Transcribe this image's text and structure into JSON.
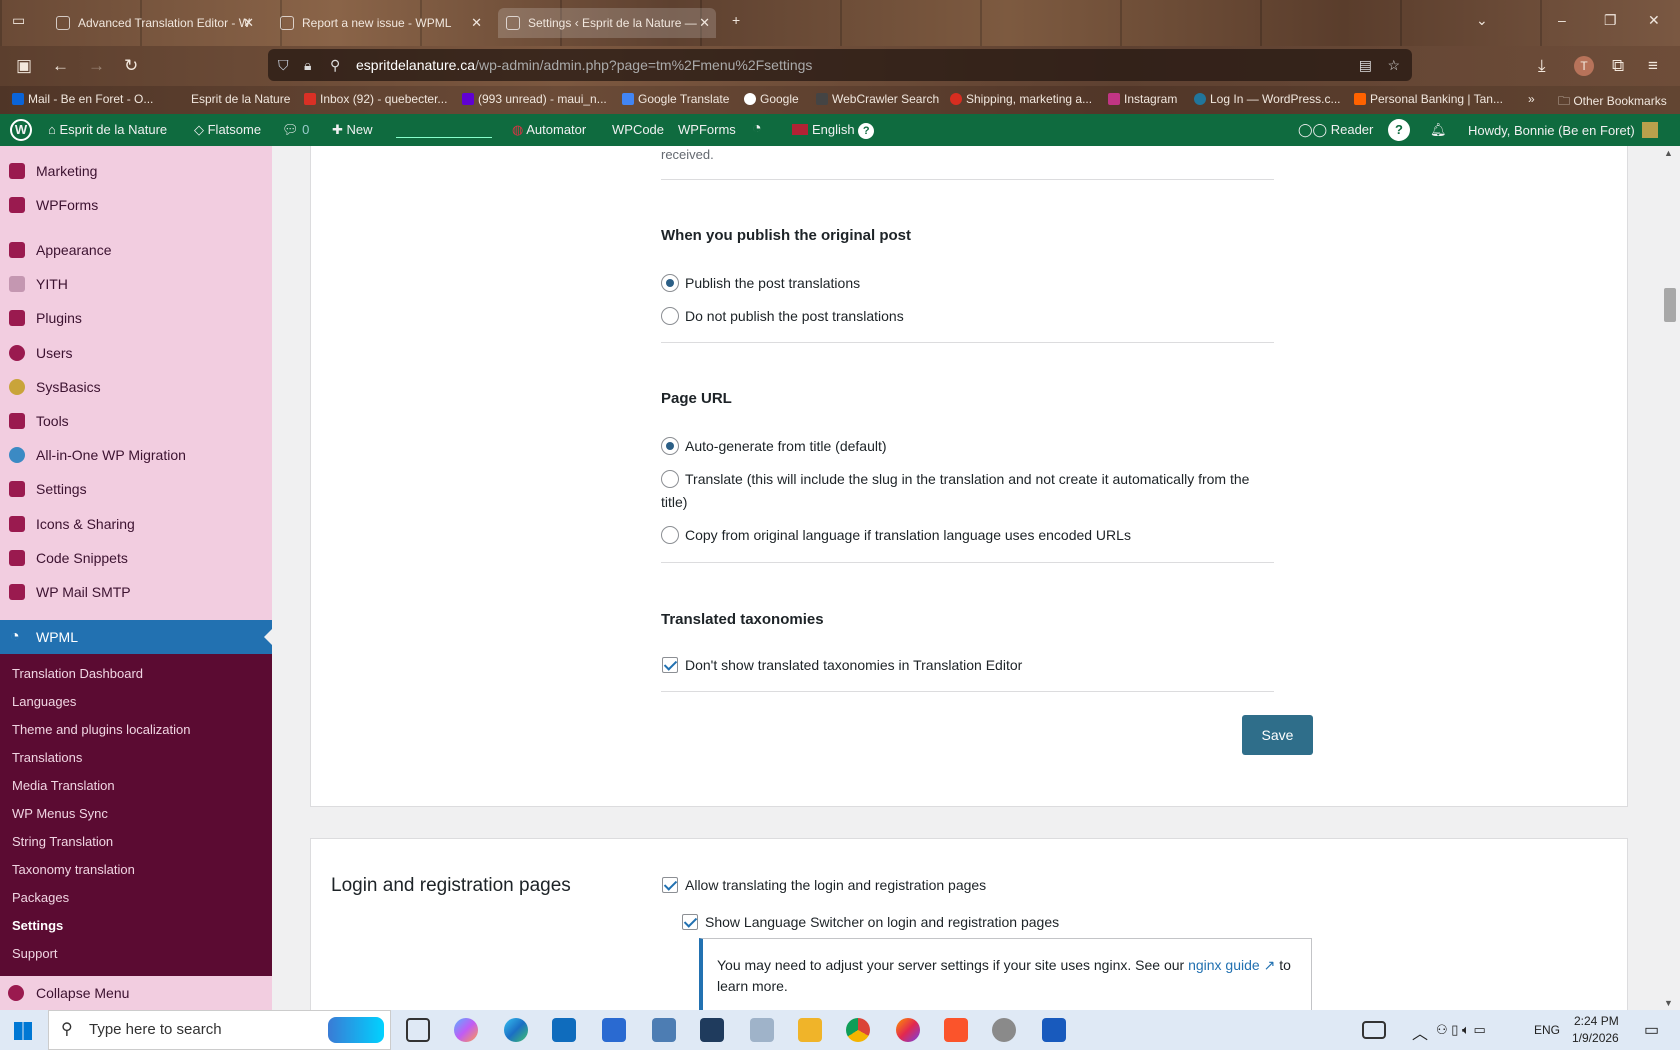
{
  "browser": {
    "tabs": [
      {
        "label": "Advanced Translation Editor - W"
      },
      {
        "label": "Report a new issue - WPML"
      },
      {
        "label": "Settings ‹ Esprit de la Nature —"
      }
    ],
    "url_host": "espritdelanature.ca",
    "url_path": "/wp-admin/admin.php?page=tm%2Fmenu%2Fsettings",
    "bookmarks": [
      {
        "label": "Mail - Be en Foret - O...",
        "color": "#0a64d8"
      },
      {
        "label": "Esprit de la Nature",
        "color": "#6b4b37"
      },
      {
        "label": "Inbox (92) - quebecter...",
        "color": "#d93025"
      },
      {
        "label": "(993 unread) - maui_n...",
        "color": "#6001d2"
      },
      {
        "label": "Google Translate",
        "color": "#4285f4"
      },
      {
        "label": "Google",
        "color": "#ffffff"
      },
      {
        "label": "WebCrawler Search",
        "color": "#444444"
      },
      {
        "label": "Shipping, marketing a...",
        "color": "#d62d20"
      },
      {
        "label": "Instagram",
        "color": "#c13584"
      },
      {
        "label": "Log In — WordPress.c...",
        "color": "#21759b"
      },
      {
        "label": "Personal Banking | Tan...",
        "color": "#ff6200"
      }
    ],
    "other_bookmarks": "Other Bookmarks"
  },
  "adminbar": {
    "site": "Esprit de la Nature",
    "flatsome": "Flatsome",
    "comments": "0",
    "new": "New",
    "automator": "Automator",
    "wpcode": "WPCode",
    "wpforms": "WPForms",
    "language": "English",
    "reader": "Reader",
    "howdy": "Howdy, Bonnie (Be en Foret)"
  },
  "sidebar": {
    "items": [
      {
        "label": "Marketing",
        "icon": "marketing-icon",
        "color": "#9a1a4f"
      },
      {
        "label": "WPForms",
        "icon": "wpforms-icon",
        "color": "#9a1a4f"
      },
      {
        "label": "Appearance",
        "icon": "appearance-icon",
        "color": "#9a1a4f"
      },
      {
        "label": "YITH",
        "icon": "yith-icon",
        "color": "#c497b1"
      },
      {
        "label": "Plugins",
        "icon": "plugins-icon",
        "color": "#9a1a4f"
      },
      {
        "label": "Users",
        "icon": "users-icon",
        "color": "#9a1a4f"
      },
      {
        "label": "SysBasics",
        "icon": "sysbasics-icon",
        "color": "#c9a43a"
      },
      {
        "label": "Tools",
        "icon": "tools-icon",
        "color": "#9a1a4f"
      },
      {
        "label": "All-in-One WP Migration",
        "icon": "migration-icon",
        "color": "#3b8ac4"
      },
      {
        "label": "Settings",
        "icon": "settings-icon",
        "color": "#9a1a4f"
      },
      {
        "label": "Icons & Sharing",
        "icon": "icons-sharing-icon",
        "color": "#9a1a4f"
      },
      {
        "label": "Code Snippets",
        "icon": "code-snippets-icon",
        "color": "#9a1a4f"
      },
      {
        "label": "WP Mail SMTP",
        "icon": "mail-smtp-icon",
        "color": "#9a1a4f"
      }
    ],
    "wpml": "WPML",
    "submenu": [
      "Translation Dashboard",
      "Languages",
      "Theme and plugins localization",
      "Translations",
      "Media Translation",
      "WP Menus Sync",
      "String Translation",
      "Taxonomy translation",
      "Packages",
      "Settings",
      "Support"
    ],
    "collapse": "Collapse Menu"
  },
  "main": {
    "received": "received.",
    "publish": {
      "heading": "When you publish the original post",
      "options": [
        "Publish the post translations",
        "Do not publish the post translations"
      ],
      "selected": 0
    },
    "page_url": {
      "heading": "Page URL",
      "options": [
        "Auto-generate from title (default)",
        "Translate (this will include the slug in the translation and not create it automatically from the",
        "title)",
        "Copy from original language if translation language uses encoded URLs"
      ],
      "selected": 0
    },
    "taxonomies": {
      "heading": "Translated taxonomies",
      "checkbox": "Don't show translated taxonomies in Translation Editor",
      "checked": true
    },
    "save": "Save",
    "login": {
      "title": "Login and registration pages",
      "allow": "Allow translating the login and registration pages",
      "switcher": "Show Language Switcher on login and registration pages",
      "notice_text": "You may need to adjust your server settings if your site uses nginx. See our",
      "notice_link": "nginx guide",
      "notice_after": "to",
      "notice_line2": "learn more."
    }
  },
  "taskbar": {
    "search_placeholder": "Type here to search",
    "lang": "ENG",
    "time": "2:24 PM",
    "date": "1/9/2026"
  }
}
